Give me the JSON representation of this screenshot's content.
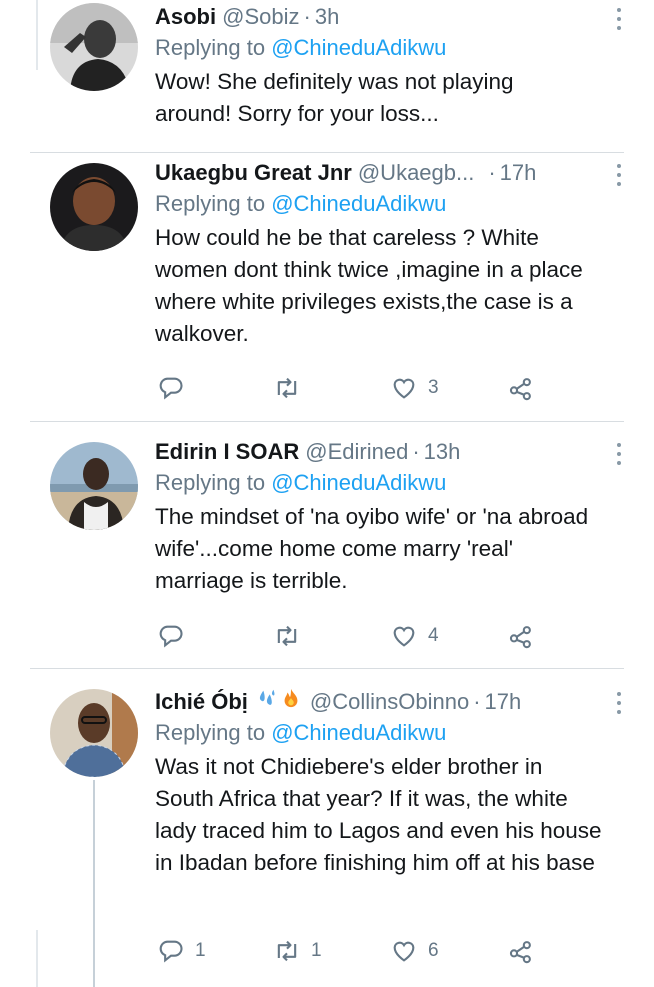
{
  "tweets": [
    {
      "name": "Asobi",
      "handle": "@Sobiz",
      "separator": "·",
      "time": "3h",
      "replying_prefix": "Replying to",
      "replying_to": "@ChineduAdikwu",
      "text": "Wow! She definitely was not playing around! Sorry for your loss...",
      "avatar_icon": "profile-photo"
    },
    {
      "name": "Ukaegbu Great Jnr",
      "handle": "@Ukaegb...",
      "separator": "·",
      "time": "17h",
      "replying_prefix": "Replying to",
      "replying_to": "@ChineduAdikwu",
      "text": "How could he be that careless ? White women dont think twice ,imagine in a place where white privileges exists,the case is a walkover.",
      "likes": "3",
      "avatar_icon": "profile-photo"
    },
    {
      "name": "Edirin I SOAR",
      "handle": "@Edirined",
      "separator": "·",
      "time": "13h",
      "replying_prefix": "Replying to",
      "replying_to": "@ChineduAdikwu",
      "text": "The mindset of 'na oyibo wife' or 'na abroad wife'...come home come marry 'real' marriage is terrible.",
      "likes": "4",
      "avatar_icon": "profile-photo"
    },
    {
      "name": "Ichié Óbị",
      "name_emojis": [
        "droplets-emoji",
        "fire-emoji"
      ],
      "handle": "@CollinsObinno",
      "separator": "·",
      "time": "17h",
      "replying_prefix": "Replying to",
      "replying_to": "@ChineduAdikwu",
      "text": "Was it not Chidiebere's elder brother in South Africa that year? If it was, the white lady traced him to Lagos and even his house in Ibadan before finishing him off at his base",
      "replies": "1",
      "retweets": "1",
      "likes": "6",
      "avatar_icon": "profile-photo"
    }
  ],
  "colors": {
    "link": "#1da1f2",
    "secondary_text": "#657786",
    "primary_text": "#14171a",
    "divider": "#d8dde1",
    "icon": "#657786"
  },
  "icons": [
    "reply-icon",
    "retweet-icon",
    "like-icon",
    "share-icon",
    "more-options-icon"
  ]
}
